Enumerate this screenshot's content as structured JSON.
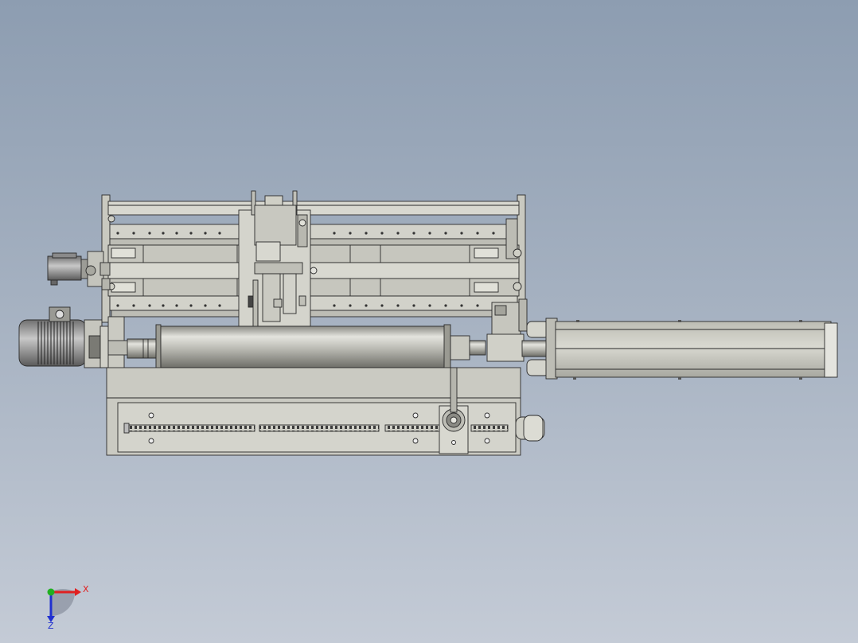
{
  "triad": {
    "x_label": "X",
    "z_label": "Z",
    "colors": {
      "x": "#e02020",
      "y": "#20b020",
      "z": "#2030d0"
    }
  },
  "palette": {
    "metal": "#cfcfc6",
    "metal_light": "#e3e3dc",
    "metal_dark": "#9c9c94",
    "line": "#2a2a2a",
    "rod_light": "#dededa",
    "rod_dark": "#7d7d78"
  }
}
